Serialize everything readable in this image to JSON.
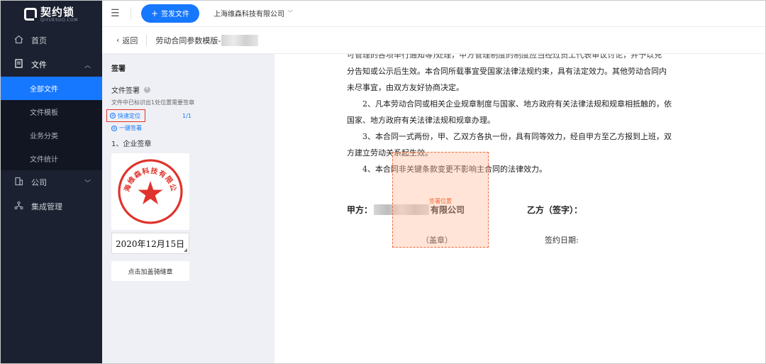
{
  "logo": {
    "text": "契约锁",
    "subtext": "QIYUESUO.COM"
  },
  "sidebar": {
    "items": [
      {
        "label": "首页",
        "icon": "home-icon"
      },
      {
        "label": "文件",
        "icon": "document-icon"
      },
      {
        "label": "公司",
        "icon": "building-icon"
      },
      {
        "label": "集成管理",
        "icon": "integration-icon"
      }
    ],
    "file_subitems": [
      {
        "label": "全部文件",
        "active": true
      },
      {
        "label": "文件模板"
      },
      {
        "label": "业务分类"
      },
      {
        "label": "文件统计"
      }
    ]
  },
  "topbar": {
    "issue_label": "签发文件",
    "company": "上海维森科技有限公司"
  },
  "subheader": {
    "back_label": "返回",
    "doc_title": "劳动合同参数模版-"
  },
  "panel": {
    "title": "签署",
    "section_title": "文件签署",
    "note": "文件中已标识出1处位置需要签章",
    "quick_locate": "快速定位",
    "quick_count": "1/1",
    "one_key": "一键签署",
    "seal_heading": "1、企业签章",
    "seal_text": "上海维森科技有限公司",
    "date_value": "2020年12月15日",
    "stamp_button": "点击加盖骑缝章"
  },
  "document": {
    "paragraphs": [
      "可管理的各项举行通知等)处理，甲方管理制度的制度应当经过员工代表审议讨论，并予以充",
      "分告知或公示后生效。本合同所载事宜受国家法律法规约束，具有法定效力。其他劳动合同内",
      "未尽事宜，由双方友好协商决定。",
      "2、凡本劳动合同或相关企业规章制度与国家、地方政府有关法律法规和规章相抵触的，依",
      "国家、地方政府有关法律法规和规章办理。",
      "3、本合同一式两份，甲、乙双方各执一份，具有同等效力，经自甲方至乙方报到上班，双",
      "方建立劳动关系起生效。",
      "4、本合同非关键条款变更不影响主合同的法律效力。"
    ],
    "party_a_label": "甲方：",
    "party_a_tail": "有限公司",
    "party_b_label": "乙方（签字）：",
    "seal_label": "（盖章）",
    "sign_date_label": "签约日期:",
    "sign_zone_label": "签署位置"
  },
  "colors": {
    "primary": "#1677ff",
    "sidebar_bg": "#1b2130",
    "seal_red": "#e0332d",
    "zone_orange": "#f06a3a"
  }
}
